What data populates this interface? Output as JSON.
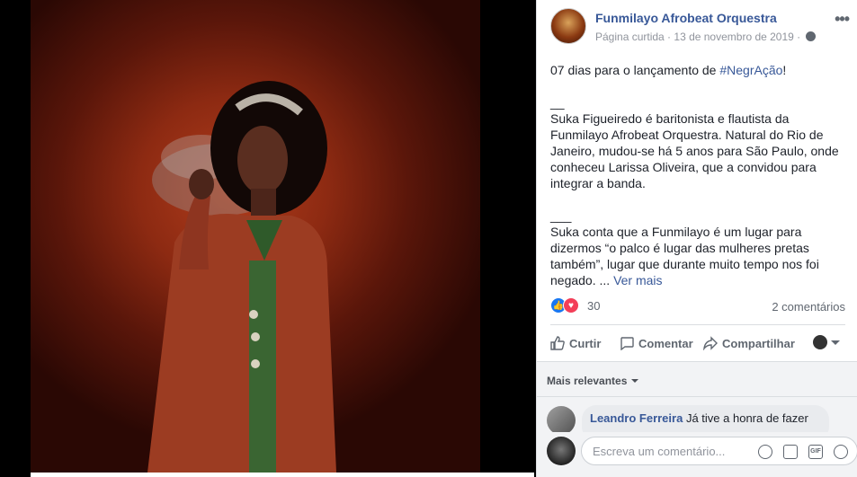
{
  "post": {
    "page_name": "Funmilayo Afrobeat Orquestra",
    "meta_status": "Página curtida",
    "meta_sep": " · ",
    "date": "13 de novembro de 2019",
    "meta_sep2": " · ",
    "more_icon": "more-options-icon",
    "intro_text": "07 dias para o lançamento de ",
    "hashtag": "#NegrAção",
    "intro_end": "!",
    "separator1": "__",
    "paragraph1": "Suka Figueiredo é baritonista e flautista da Funmilayo Afrobeat Orquestra. Natural do Rio de Janeiro, mudou-se há 5 anos para São Paulo, onde conheceu Larissa Oliveira, que a convidou para integrar a banda.",
    "separator2": "___",
    "paragraph2": "Suka conta que a Funmilayo é um lugar para dizermos “o palco é lugar das mulheres pretas também”, lugar que durante muito tempo nos foi negado. ... ",
    "see_more": "Ver mais"
  },
  "stats": {
    "reaction_count": "30",
    "comments_count": "2 comentários"
  },
  "actions": {
    "like": "Curtir",
    "comment": "Comentar",
    "share": "Compartilhar"
  },
  "comments": {
    "sort_label": "Mais relevantes",
    "items": [
      {
        "author": "Leandro Ferreira",
        "text": "Já tive a honra de fazer"
      }
    ],
    "composer_placeholder": "Escreva um comentário..."
  },
  "colors": {
    "link": "#385898",
    "like_blue": "#1877f2",
    "love_red": "#f33e58"
  }
}
